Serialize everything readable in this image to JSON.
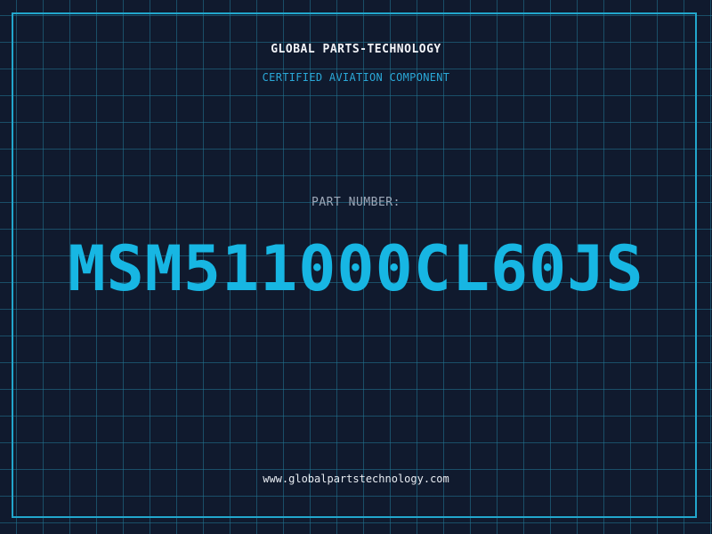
{
  "brand": {
    "name": "GLOBAL PARTS-TECHNOLOGY",
    "tagline": "CERTIFIED AVIATION COMPONENT"
  },
  "part": {
    "label": "PART NUMBER:",
    "number": "MSM511000CL60JS"
  },
  "footer": {
    "website": "www.globalpartstechnology.com"
  },
  "colors": {
    "background": "#101a2e",
    "grid": "#22788f",
    "accent": "#17b6e3",
    "text": "#f2f4f8"
  }
}
